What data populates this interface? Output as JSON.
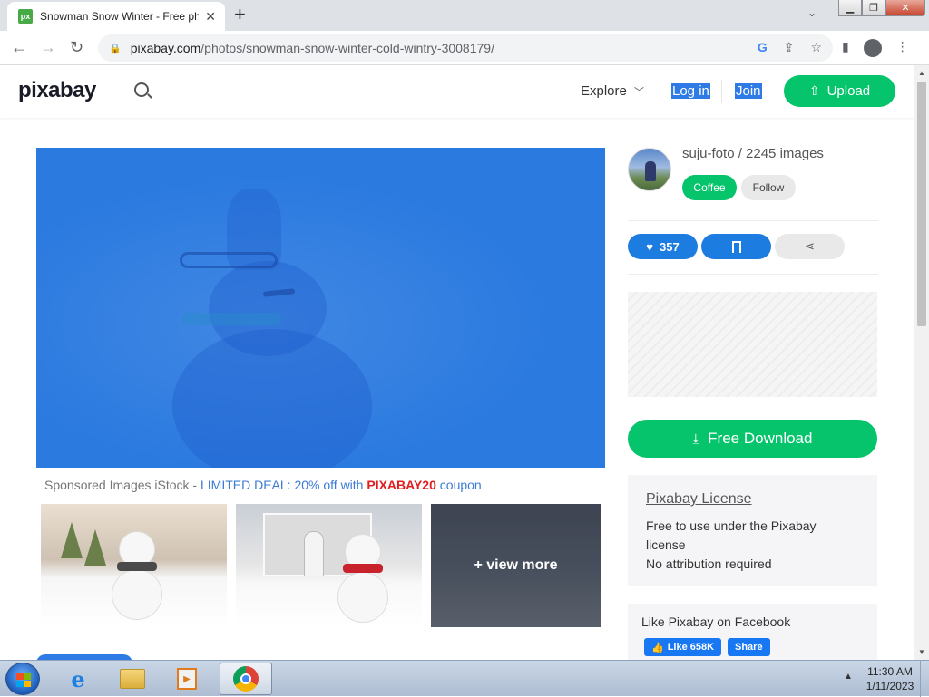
{
  "browser": {
    "tab_title": "Snowman Snow Winter - Free ph",
    "favicon_text": "px",
    "new_tab_icon": "plus-icon",
    "url_domain": "pixabay.com",
    "url_path": "/photos/snowman-snow-winter-cold-wintry-3008179/",
    "google_icon_text": "G"
  },
  "site": {
    "logo": "pixabay",
    "explore_label": "Explore",
    "login_label": "Log in",
    "join_label": "Join",
    "upload_label": "Upload"
  },
  "sponsored": {
    "prefix": "Sponsored Images iStock - ",
    "deal": "LIMITED DEAL: 20% off with ",
    "code": "PIXABAY20",
    "suffix": " coupon"
  },
  "thumbs": {
    "view_more": "+ view more"
  },
  "author": {
    "name_line": "suju-foto / 2245 images",
    "coffee_label": "Coffee",
    "follow_label": "Follow"
  },
  "actions": {
    "likes": "357"
  },
  "download": {
    "label": "Free Download"
  },
  "license": {
    "title": "Pixabay License",
    "line1": "Free to use under the Pixabay license",
    "line2": "No attribution required"
  },
  "facebook": {
    "title": "Like Pixabay on Facebook",
    "like_label": "Like 658K",
    "share_label": "Share"
  },
  "taskbar": {
    "time": "11:30 AM",
    "date": "1/11/2023"
  },
  "colors": {
    "brand_green": "#05c46b",
    "accent_blue": "#1d7ce0",
    "selection_blue": "#2f7be6",
    "coupon_red": "#e02020"
  }
}
